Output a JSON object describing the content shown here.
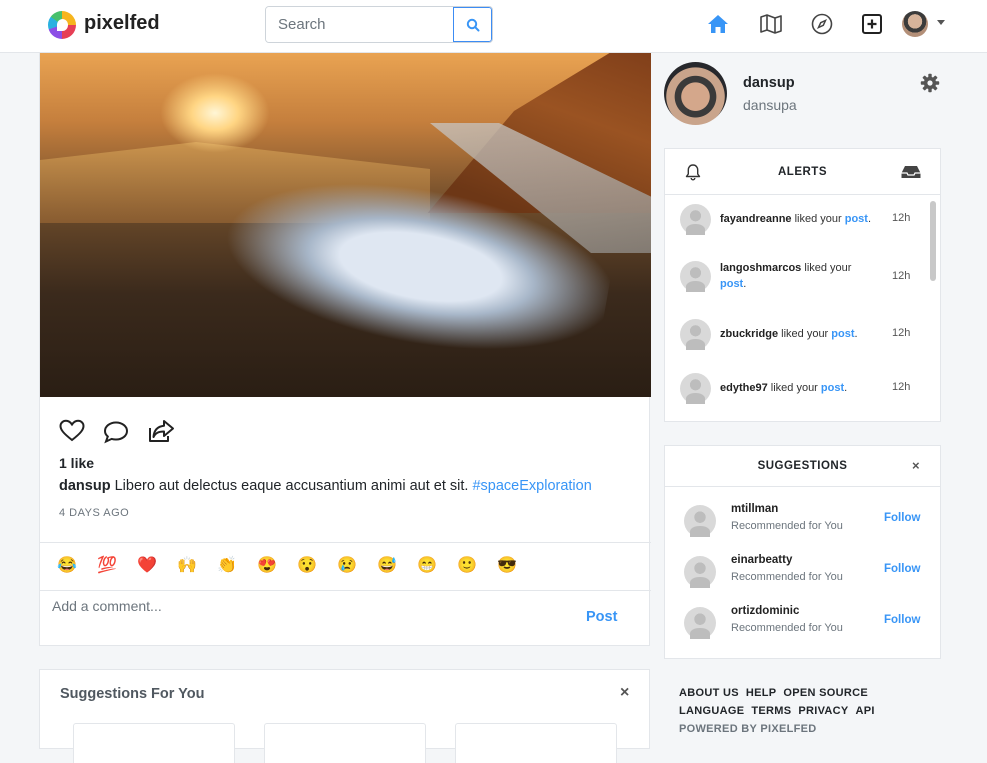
{
  "nav": {
    "brand": "pixelfed",
    "search_placeholder": "Search",
    "icons": [
      "home-icon",
      "map-icon",
      "compass-icon",
      "plus-square-icon",
      "avatar",
      "chevron-down-icon"
    ],
    "active_color": "#3895f6"
  },
  "post": {
    "likes": "1 like",
    "username": "dansup",
    "caption_text": "Libero aut delectus eaque accusantium animi aut et sit.",
    "hashtag": "#spaceExploration",
    "time_ago": "4 DAYS AGO",
    "emojis": [
      "😂",
      "💯",
      "❤️",
      "🙌",
      "👏",
      "😍",
      "😯",
      "😢",
      "😅",
      "😁",
      "🙂",
      "😎"
    ],
    "comment_placeholder": "Add a comment...",
    "post_label": "Post"
  },
  "suggestions_for_you": {
    "title": "Suggestions For You",
    "close": "×"
  },
  "profile": {
    "name": "dansup",
    "handle": "dansupa"
  },
  "alerts": {
    "title": "ALERTS",
    "items": [
      {
        "user": "fayandreanne",
        "action": "liked your",
        "link": "post",
        "time": "12h"
      },
      {
        "user": "langoshmarcos",
        "action": "liked your",
        "link": "post",
        "time": "12h"
      },
      {
        "user": "zbuckridge",
        "action": "liked your",
        "link": "post",
        "time": "12h"
      },
      {
        "user": "edythe97",
        "action": "liked your",
        "link": "post",
        "time": "12h"
      }
    ]
  },
  "suggestions": {
    "title": "SUGGESTIONS",
    "close": "×",
    "items": [
      {
        "name": "mtillman",
        "sub": "Recommended for You",
        "action": "Follow"
      },
      {
        "name": "einarbeatty",
        "sub": "Recommended for You",
        "action": "Follow"
      },
      {
        "name": "ortizdominic",
        "sub": "Recommended for You",
        "action": "Follow"
      }
    ]
  },
  "footer": {
    "links1": [
      "ABOUT US",
      "HELP",
      "OPEN SOURCE"
    ],
    "links2": [
      "LANGUAGE",
      "TERMS",
      "PRIVACY",
      "API"
    ],
    "powered": "POWERED BY PIXELFED"
  }
}
